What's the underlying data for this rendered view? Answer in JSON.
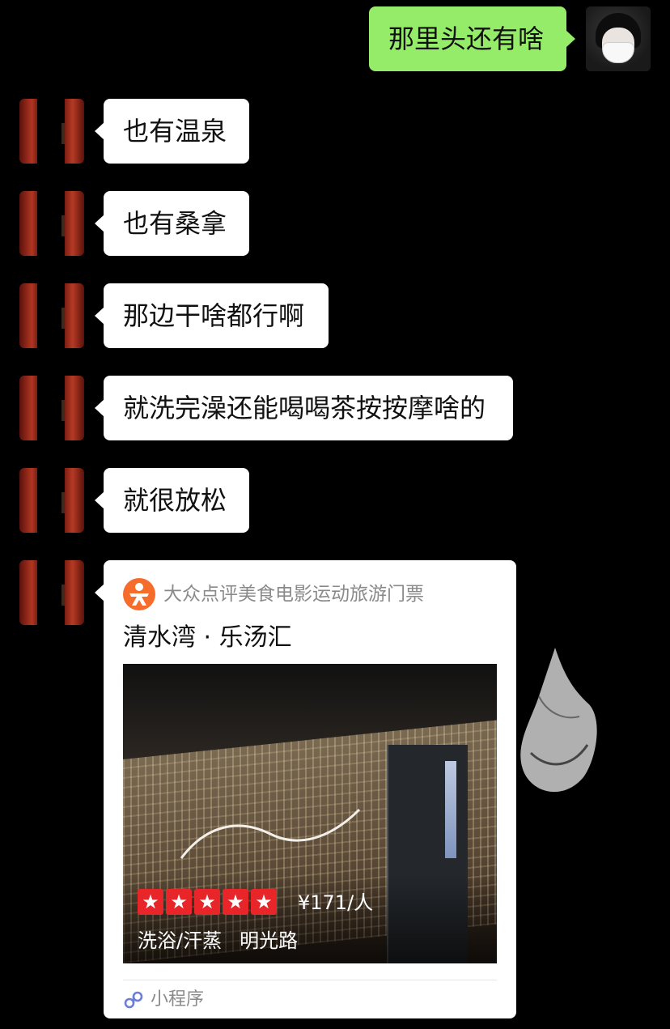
{
  "chat": {
    "self_avatar": "self-avatar-masked",
    "other_avatar": "other-avatar-red",
    "messages": [
      {
        "from": "self",
        "text": "那里头还有啥"
      },
      {
        "from": "other",
        "text": "也有温泉"
      },
      {
        "from": "other",
        "text": "也有桑拿"
      },
      {
        "from": "other",
        "text": "那边干啥都行啊"
      },
      {
        "from": "other",
        "text": "就洗完澡还能喝喝茶按按摩啥的"
      },
      {
        "from": "other",
        "text": "就很放松"
      }
    ],
    "card": {
      "source": "大众点评美食电影运动旅游门票",
      "title": "清水湾 · 乐汤汇",
      "rating_stars": 5,
      "price": "¥171/人",
      "tags": [
        "洗浴/汗蒸",
        "明光路"
      ],
      "footer": "小程序",
      "logo_icon": "dianping-logo-icon",
      "footer_icon": "mini-program-icon",
      "accent": "#f56c2b"
    }
  },
  "colors": {
    "background": "#000000",
    "bubble_out": "#95ec69",
    "bubble_in": "#ffffff",
    "star": "#e8262a"
  }
}
